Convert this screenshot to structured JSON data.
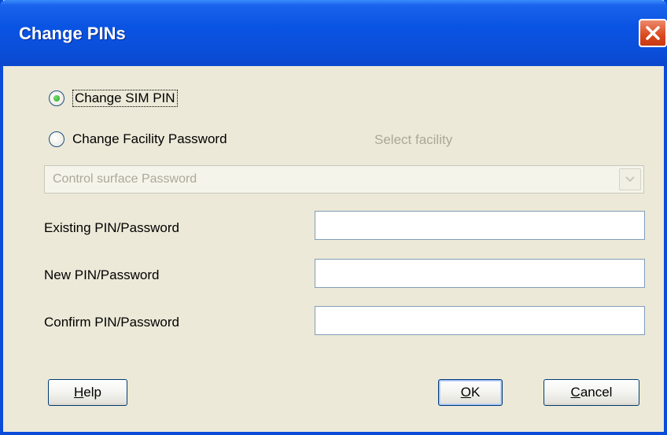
{
  "window": {
    "title": "Change PINs"
  },
  "options": {
    "change_sim_pin": {
      "label": "Change SIM PIN",
      "selected": true
    },
    "change_facility_password": {
      "label": "Change Facility Password",
      "selected": false
    }
  },
  "facility": {
    "label": "Select facility",
    "selected_value": "Control surface Password"
  },
  "fields": {
    "existing": {
      "label": "Existing PIN/Password",
      "value": ""
    },
    "new": {
      "label": "New PIN/Password",
      "value": ""
    },
    "confirm": {
      "label": "Confirm PIN/Password",
      "value": ""
    }
  },
  "buttons": {
    "help": {
      "mnemonic": "H",
      "rest": "elp"
    },
    "ok": {
      "mnemonic": "O",
      "rest": "K"
    },
    "cancel": {
      "mnemonic": "C",
      "rest": "ancel"
    }
  },
  "colors": {
    "titlebar": "#0a54e3",
    "face": "#ece9d8",
    "close": "#d9481e"
  }
}
